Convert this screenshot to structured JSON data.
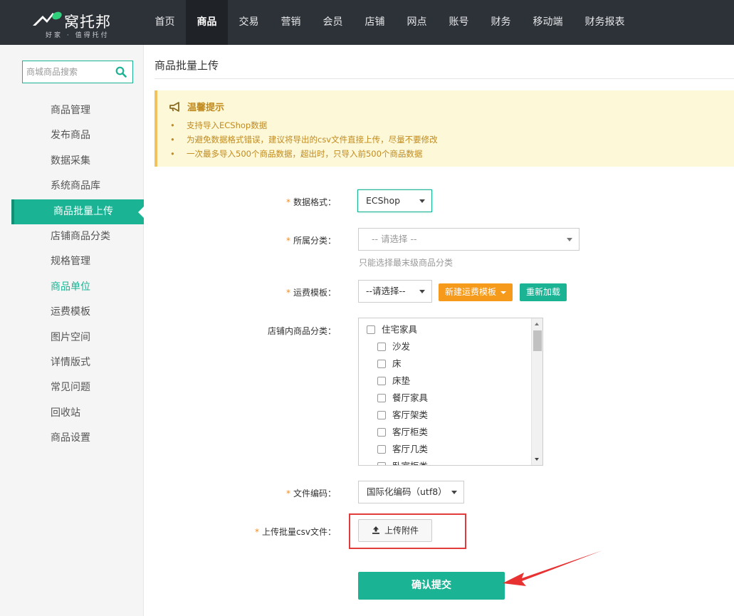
{
  "brand": {
    "name": "窝托邦",
    "slogan": "好家 · 值得托付",
    "accent": "#1ab394"
  },
  "nav": {
    "items": [
      {
        "label": "首页",
        "active": false
      },
      {
        "label": "商品",
        "active": true
      },
      {
        "label": "交易",
        "active": false
      },
      {
        "label": "营销",
        "active": false
      },
      {
        "label": "会员",
        "active": false
      },
      {
        "label": "店铺",
        "active": false
      },
      {
        "label": "网点",
        "active": false
      },
      {
        "label": "账号",
        "active": false
      },
      {
        "label": "财务",
        "active": false
      },
      {
        "label": "移动端",
        "active": false
      },
      {
        "label": "财务报表",
        "active": false
      }
    ]
  },
  "sidebar": {
    "search_placeholder": "商城商品搜索",
    "items": [
      {
        "label": "商品管理",
        "state": ""
      },
      {
        "label": "发布商品",
        "state": ""
      },
      {
        "label": "数据采集",
        "state": ""
      },
      {
        "label": "系统商品库",
        "state": ""
      },
      {
        "label": "商品批量上传",
        "state": "active"
      },
      {
        "label": "店铺商品分类",
        "state": ""
      },
      {
        "label": "规格管理",
        "state": ""
      },
      {
        "label": "商品单位",
        "state": "highlight"
      },
      {
        "label": "运费模板",
        "state": ""
      },
      {
        "label": "图片空间",
        "state": ""
      },
      {
        "label": "详情版式",
        "state": ""
      },
      {
        "label": "常见问题",
        "state": ""
      },
      {
        "label": "回收站",
        "state": ""
      },
      {
        "label": "商品设置",
        "state": ""
      }
    ]
  },
  "page": {
    "title": "商品批量上传"
  },
  "notice": {
    "title": "温馨提示",
    "items": [
      "支持导入ECShop数据",
      "为避免数据格式错误，建议将导出的csv文件直接上传，尽量不要修改",
      "一次最多导入500个商品数据，超出时，只导入前500个商品数据"
    ]
  },
  "form": {
    "required_mark": "*",
    "data_format": {
      "label": "数据格式：",
      "value": "ECShop"
    },
    "category": {
      "label": "所属分类：",
      "value": "-- 请选择 --",
      "help": "只能选择最末级商品分类"
    },
    "shipping": {
      "label": "运费模板：",
      "value": "--请选择--",
      "new_btn": "新建运费模板",
      "reload_btn": "重新加载"
    },
    "shop_category": {
      "label": "店铺内商品分类：",
      "tree": [
        {
          "label": "住宅家具",
          "level": 0,
          "checked": false
        },
        {
          "label": "沙发",
          "level": 1,
          "checked": false
        },
        {
          "label": "床",
          "level": 1,
          "checked": false
        },
        {
          "label": "床垫",
          "level": 1,
          "checked": false
        },
        {
          "label": "餐厅家具",
          "level": 1,
          "checked": false
        },
        {
          "label": "客厅架类",
          "level": 1,
          "checked": false
        },
        {
          "label": "客厅柜类",
          "level": 1,
          "checked": false
        },
        {
          "label": "客厅几类",
          "level": 1,
          "checked": false
        },
        {
          "label": "卧室柜类",
          "level": 1,
          "checked": false
        }
      ]
    },
    "encoding": {
      "label": "文件编码：",
      "value": "国际化编码（utf8）"
    },
    "upload": {
      "label": "上传批量csv文件：",
      "button": "上传附件"
    },
    "submit": "确认提交"
  }
}
